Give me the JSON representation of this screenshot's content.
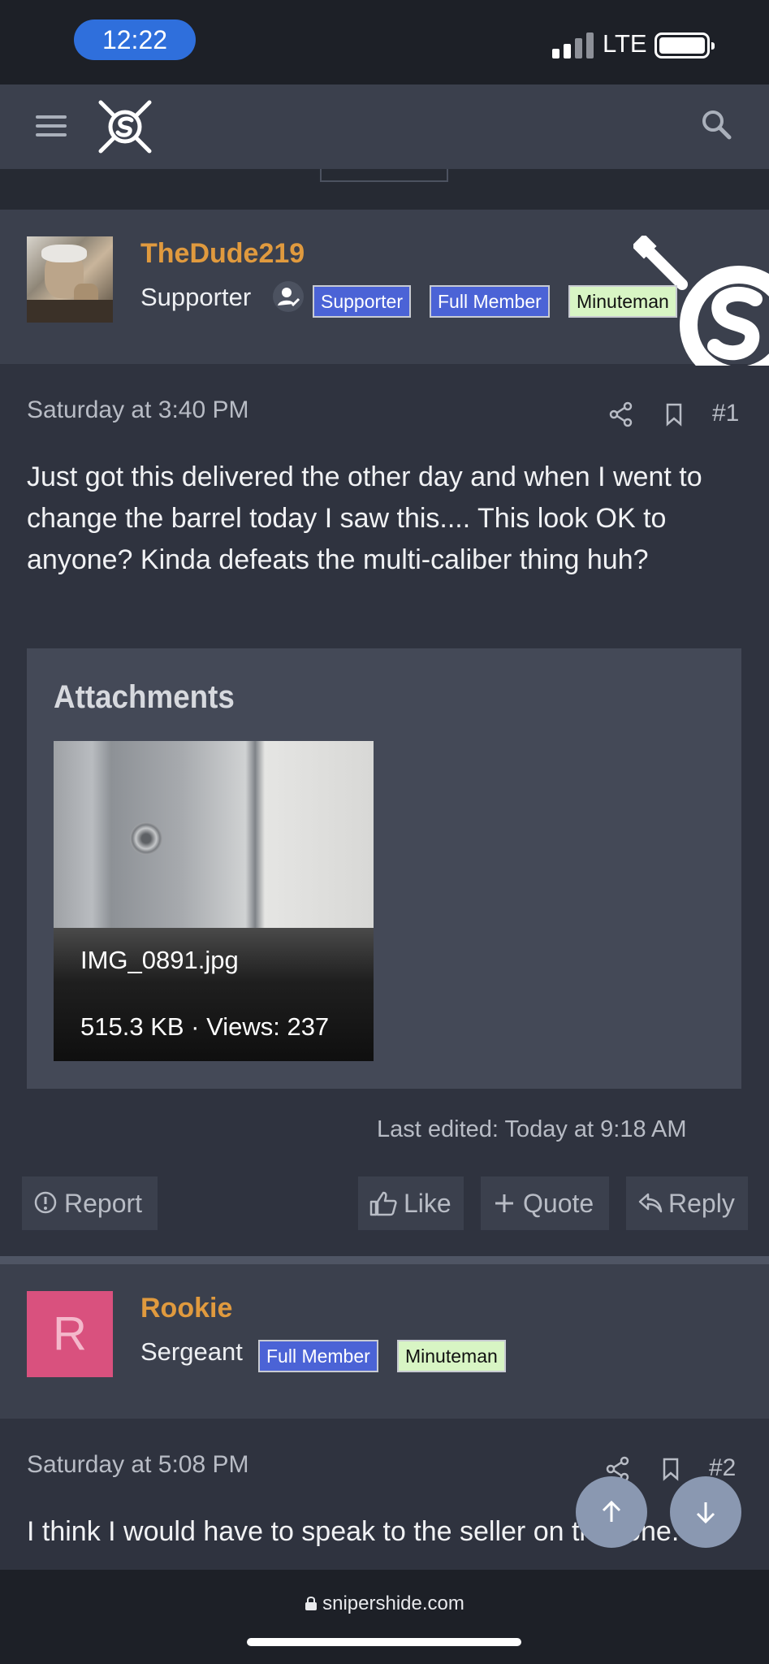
{
  "status_bar": {
    "time": "12:22",
    "network": "LTE"
  },
  "nav": {
    "logo": "snipershide-logo"
  },
  "post1": {
    "username": "TheDude219",
    "user_title": "Supporter",
    "badges": [
      "Supporter",
      "Full Member",
      "Minuteman"
    ],
    "date": "Saturday at 3:40 PM",
    "number": "#1",
    "text": "Just got this delivered the other day and when I went to change the barrel today I saw this.... This look OK to anyone? Kinda defeats the multi-caliber thing huh?",
    "attachments_title": "Attachments",
    "attachment": {
      "filename": "IMG_0891.jpg",
      "meta": "515.3 KB · Views: 237"
    },
    "last_edited": "Last edited: Today at 9:18 AM",
    "actions": {
      "report": "Report",
      "like": "Like",
      "quote": "Quote",
      "reply": "Reply"
    }
  },
  "post2": {
    "avatar_letter": "R",
    "username": "Rookie",
    "user_title": "Sergeant",
    "badges": [
      "Full Member",
      "Minuteman"
    ],
    "date": "Saturday at 5:08 PM",
    "number": "#2",
    "text": "I think I would have to speak to the seller on that one."
  },
  "browser": {
    "url": "snipershide.com"
  },
  "colors": {
    "username": "#e09a3e",
    "badge_blue": "#4b63d6",
    "badge_green": "#d8f5c4",
    "avatar_r": "#d9517e"
  }
}
